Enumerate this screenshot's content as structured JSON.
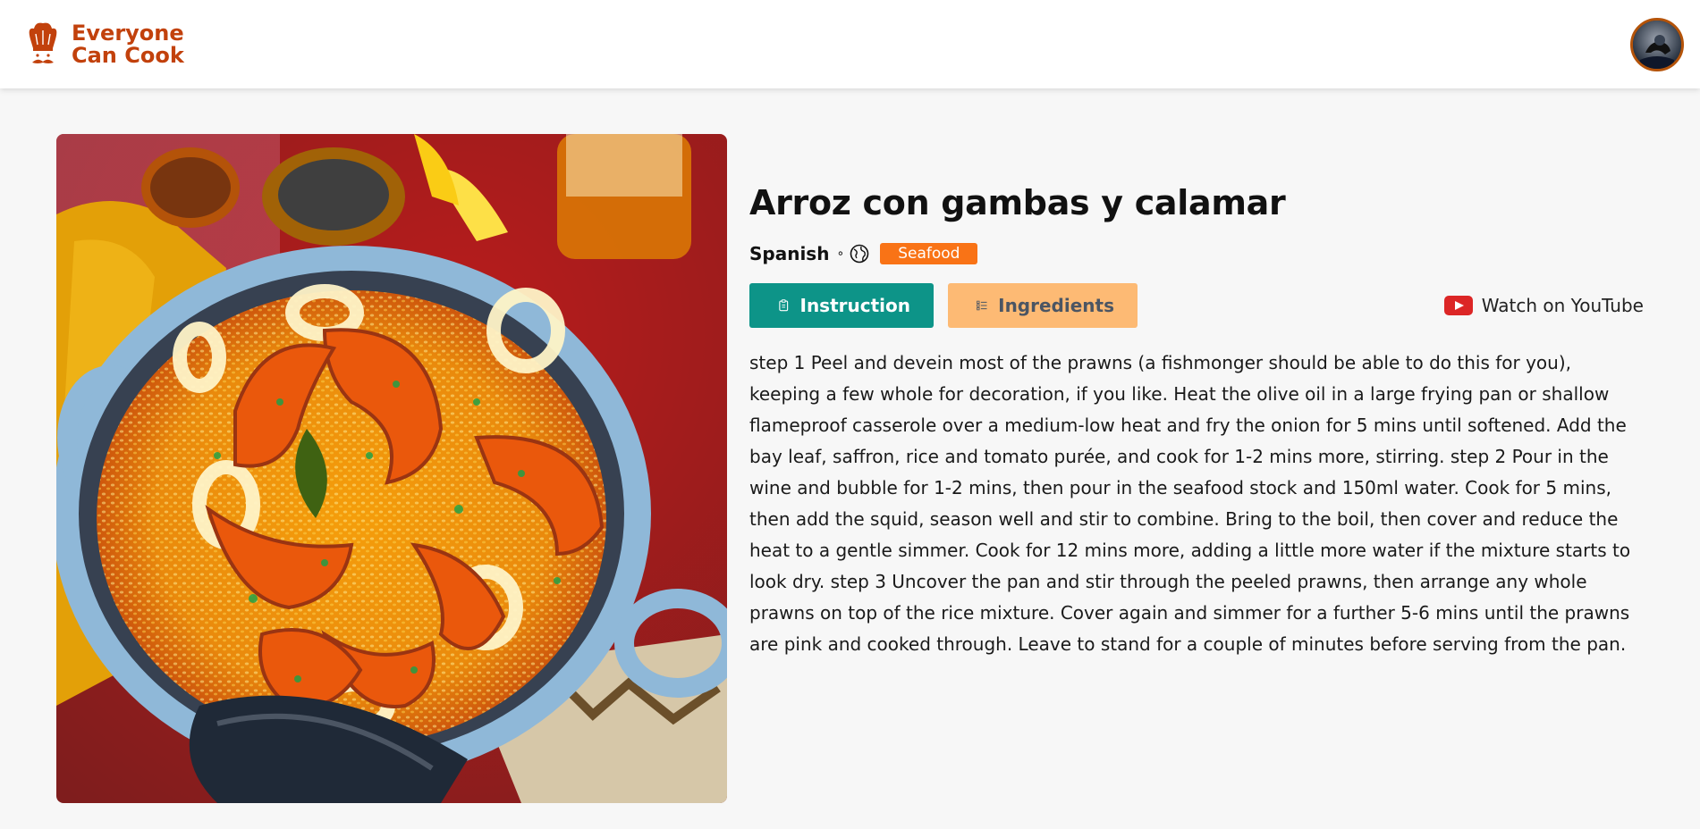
{
  "header": {
    "brand_line1": "Everyone",
    "brand_line2": "Can Cook",
    "brand_icon": "chef-hat-mustache-icon",
    "avatar": "user-avatar"
  },
  "meal": {
    "title": "Arroz con gambas y calamar",
    "area": "Spanish",
    "category": "Seafood",
    "image_alt": "Arroz con gambas y calamar"
  },
  "tabs": {
    "instruction": "Instruction",
    "ingredients": "Ingredients"
  },
  "youtube": {
    "label": "Watch on YouTube",
    "icon": "youtube-icon"
  },
  "instructions": "step 1 Peel and devein most of the prawns (a fishmonger should be able to do this for you), keeping a few whole for decoration, if you like. Heat the olive oil in a large frying pan or shallow flameproof casserole over a medium-low heat and fry the onion for 5 mins until softened. Add the bay leaf, saffron, rice and tomato purée, and cook for 1-2 mins more, stirring. step 2 Pour in the wine and bubble for 1-2 mins, then pour in the seafood stock and 150ml water. Cook for 5 mins, then add the squid, season well and stir to combine. Bring to the boil, then cover and reduce the heat to a gentle simmer. Cook for 12 mins more, adding a little more water if the mixture starts to look dry. step 3 Uncover the pan and stir through the peeled prawns, then arrange any whole prawns on top of the rice mixture. Cover again and simmer for a further 5-6 mins until the prawns are pink and cooked through. Leave to stand for a couple of minutes before serving from the pan.",
  "colors": {
    "brand": "#c2410c",
    "instruction_button": "#0d9488",
    "ingredients_button": "#fdba74",
    "category_tag": "#f97316",
    "youtube_red": "#dc2626"
  }
}
